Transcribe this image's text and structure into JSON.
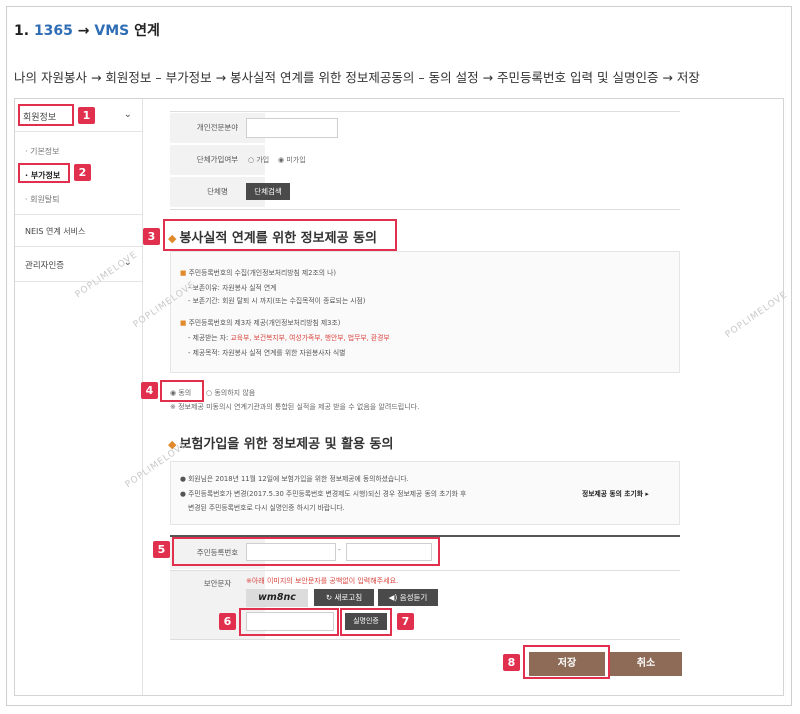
{
  "heading": {
    "num": "1.",
    "code": "1365",
    "arrow": "→",
    "target": "VMS",
    "suffix": "연계"
  },
  "description": "나의 자원봉사 → 회원정보 – 부가정보 → 봉사실적 연계를 위한 정보제공동의 – 동의 설정 → 주민등록번호 입력 및 실명인증 → 저장",
  "sidebar": {
    "member_info": "회원정보",
    "sub_items": [
      "· 기본정보",
      "· 부가정보",
      "· 회원탈퇴"
    ],
    "neis": "NEIS 연계 서비스",
    "admin": "관리자인증"
  },
  "form": {
    "personal_field_label": "개인전문분야",
    "group_join_label": "단체가입여부",
    "join_opt": "가입",
    "nojoin_opt": "미가입",
    "group_name_label": "단체명",
    "group_search_btn": "단체검색"
  },
  "section1": {
    "title": "봉사실적 연계를 위한 정보제공 동의",
    "lines": [
      "주민등록번호의 수집(개인정보처리방침 제2조의 나)",
      "- 보존이유: 자원봉사 실적 연계",
      "- 보존기간: 회원 탈퇴 시 까지(또는 수집목적이 종료되는 시점)",
      "주민등록번호의 제3자 제공(개인정보처리방침 제3조)",
      "- 제공받는 자:",
      "교육부, 보건복지부, 여성가족부, 행안부, 법무부, 환경부",
      "- 제공목적: 자원봉사 실적 연계를 위한 자원봉사자 식별"
    ],
    "agree": "동의",
    "disagree": "동의하지 않음",
    "note": "※ 정보제공 미동의시 연계기관과의 통합된 실적을 제공 받을 수 없음을 알려드립니다."
  },
  "section2": {
    "title": "보험가입을 위한 정보제공 및 활용 동의",
    "lines": [
      "회원님은 2018년 11월 12일에 보험가입을 위한 정보제공에 동의하셨습니다.",
      "주민등록번호가 변경(2017.5.30 주민등록번호 변경제도 시행)되신 경우 정보제공 동의 초기화 후",
      "변경된 주민등록번호로 다시 실명인증 하시기 바랍니다."
    ],
    "reset": "정보제공 동의 초기화 ▸"
  },
  "rrn": {
    "label": "주민등록번호",
    "dash": "-",
    "captcha_label": "보안문자",
    "captcha_warning": "※아래 이미지의 보안문자를 공백없이 입력해주세요.",
    "captcha_text": "wm8nc",
    "refresh": "새로고침",
    "audio": "음성듣기",
    "verify": "실명인증"
  },
  "buttons": {
    "save": "저장",
    "cancel": "취소"
  },
  "badges": [
    "1",
    "2",
    "3",
    "4",
    "5",
    "6",
    "7",
    "8"
  ],
  "watermark": "POPLIMELOVE"
}
